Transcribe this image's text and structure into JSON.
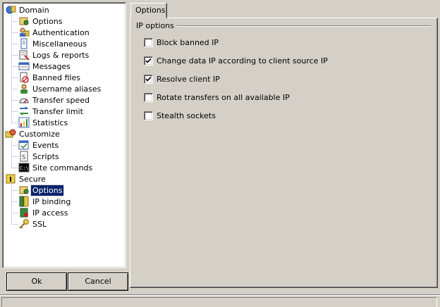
{
  "tree": {
    "items": [
      {
        "label": "Domain",
        "icon": "domain-icon",
        "level": 0,
        "selected": false
      },
      {
        "label": "Options",
        "icon": "options-icon",
        "level": 1,
        "selected": false
      },
      {
        "label": "Authentication",
        "icon": "authentication-icon",
        "level": 1,
        "selected": false
      },
      {
        "label": "Miscellaneous",
        "icon": "miscellaneous-icon",
        "level": 1,
        "selected": false
      },
      {
        "label": "Logs & reports",
        "icon": "logs-reports-icon",
        "level": 1,
        "selected": false
      },
      {
        "label": "Messages",
        "icon": "messages-icon",
        "level": 1,
        "selected": false
      },
      {
        "label": "Banned files",
        "icon": "banned-files-icon",
        "level": 1,
        "selected": false
      },
      {
        "label": "Username aliases",
        "icon": "username-aliases-icon",
        "level": 1,
        "selected": false
      },
      {
        "label": "Transfer speed",
        "icon": "transfer-speed-icon",
        "level": 1,
        "selected": false
      },
      {
        "label": "Transfer limit",
        "icon": "transfer-limit-icon",
        "level": 1,
        "selected": false
      },
      {
        "label": "Statistics",
        "icon": "statistics-icon",
        "level": 1,
        "selected": false
      },
      {
        "label": "Customize",
        "icon": "customize-icon",
        "level": 0,
        "selected": false
      },
      {
        "label": "Events",
        "icon": "events-icon",
        "level": 1,
        "selected": false
      },
      {
        "label": "Scripts",
        "icon": "scripts-icon",
        "level": 1,
        "selected": false
      },
      {
        "label": "Site commands",
        "icon": "site-commands-icon",
        "level": 1,
        "selected": false
      },
      {
        "label": "Secure",
        "icon": "secure-icon",
        "level": 0,
        "selected": false
      },
      {
        "label": "Options",
        "icon": "options-icon",
        "level": 1,
        "selected": true
      },
      {
        "label": "IP binding",
        "icon": "ip-binding-icon",
        "level": 1,
        "selected": false
      },
      {
        "label": "IP access",
        "icon": "ip-access-icon",
        "level": 1,
        "selected": false
      },
      {
        "label": "SSL",
        "icon": "ssl-key-icon",
        "level": 1,
        "selected": false
      }
    ]
  },
  "buttons": {
    "ok_label": "Ok",
    "cancel_label": "Cancel"
  },
  "tab": {
    "label": "Options"
  },
  "group": {
    "title": "IP options"
  },
  "options": [
    {
      "label": "Block banned IP",
      "checked": false
    },
    {
      "label": "Change data IP according to client source IP",
      "checked": true
    },
    {
      "label": "Resolve client IP",
      "checked": true
    },
    {
      "label": "Rotate transfers on all available IP",
      "checked": false
    },
    {
      "label": "Stealth sockets",
      "checked": false
    }
  ],
  "colors": {
    "selection": "#0a246a",
    "face": "#d4d0c8"
  }
}
